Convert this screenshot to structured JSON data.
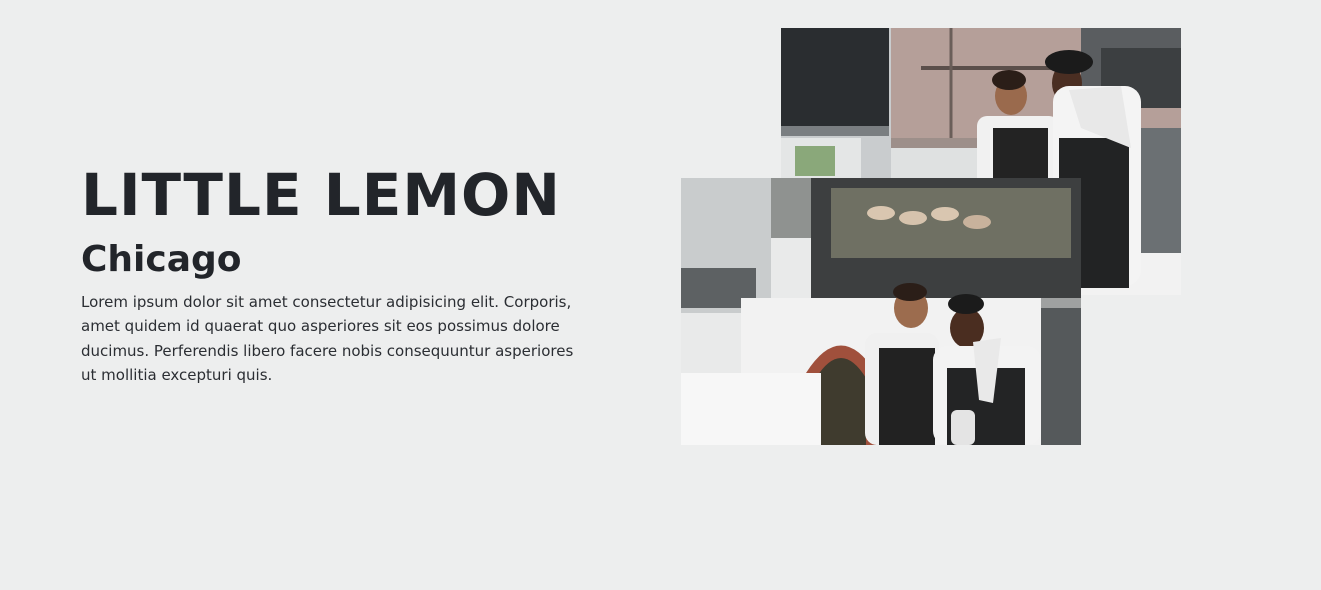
{
  "hero": {
    "title": "LITTLE LEMON",
    "subtitle": "Chicago",
    "description": "Lorem ipsum dolor sit amet consectetur adipisicing elit. Corporis, amet quidem id quaerat quo asperiores sit eos possimus dolore ducimus. Perferendis libero facere nobis consequuntur asperiores ut mollitia excepturi quis."
  }
}
